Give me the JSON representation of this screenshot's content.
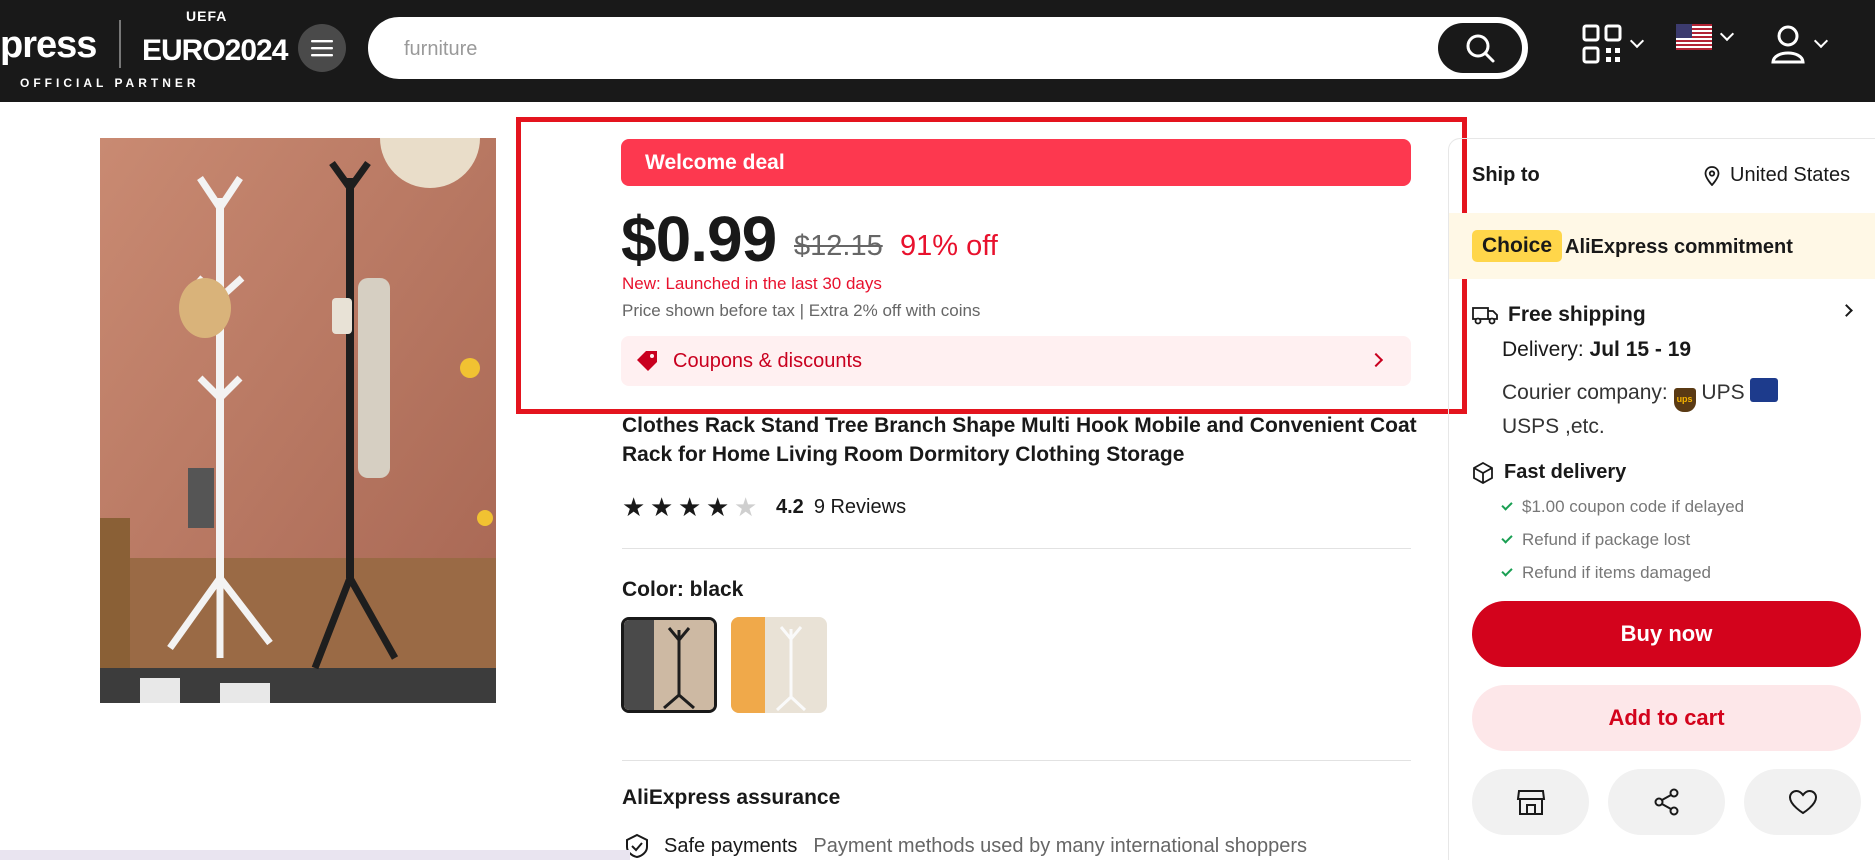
{
  "header": {
    "brand_partial": "press",
    "uefa": "UEFA",
    "euro": "EURO2024",
    "partner": "OFFICIAL PARTNER",
    "search_value": "furniture",
    "qr_icon": "qr-code-icon",
    "flag_icon": "us-flag-icon",
    "account_icon": "user-icon"
  },
  "deal": {
    "banner": "Welcome deal",
    "price": "$0.99",
    "old_price": "$12.15",
    "discount": "91% off",
    "new_tag": "New: Launched in the last 30 days",
    "tax_line": "Price shown before tax  |  Extra 2% off with coins",
    "coupons_label": "Coupons & discounts"
  },
  "product": {
    "title": "Clothes Rack Stand Tree Branch Shape Multi Hook Mobile and Convenient Coat Rack for Home Living Room Dormitory Clothing Storage",
    "rating": "4.2",
    "rating_value": 4.2,
    "reviews": "9 Reviews",
    "color_label": "Color: black",
    "assurance_title": "AliExpress assurance",
    "safe_payments": "Safe payments",
    "safe_payments_desc": "Payment methods used by many international shoppers"
  },
  "shipping": {
    "ship_to": "Ship to",
    "country": "United States",
    "choice": "Choice",
    "commitment": "AliExpress commitment",
    "free_shipping": "Free shipping",
    "delivery_label": "Delivery:",
    "delivery_dates": "Jul 15 - 19",
    "courier_label": "Courier company:",
    "courier_ups": "UPS",
    "courier_rest": "USPS ,etc.",
    "fast_delivery": "Fast delivery",
    "guarantees": [
      "$1.00 coupon code if delayed",
      "Refund if package lost",
      "Refund if items damaged"
    ]
  },
  "actions": {
    "buy_now": "Buy now",
    "add_to_cart": "Add to cart"
  },
  "colors": {
    "header_bg": "#191919",
    "accent_red": "#d3031c",
    "welcome_red": "#fd384f",
    "highlight_border": "#e4141e",
    "choice_yellow": "#ffd64a"
  }
}
